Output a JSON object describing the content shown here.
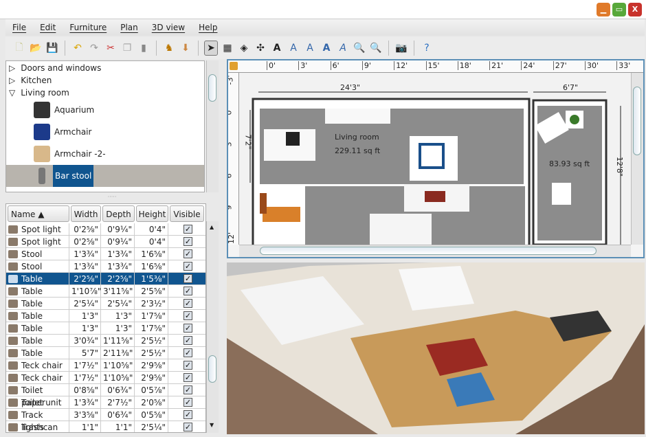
{
  "window": {
    "buttons": [
      "minimize",
      "maximize",
      "close"
    ],
    "colors": {
      "minimize": "#e07a2a",
      "maximize": "#58a83a",
      "close": "#c8322c"
    }
  },
  "menu": [
    "File",
    "Edit",
    "Furniture",
    "Plan",
    "3D view",
    "Help"
  ],
  "toolbar": [
    "new-icon",
    "open-icon",
    "save-icon",
    "undo-icon",
    "redo-icon",
    "cut-icon",
    "copy-icon",
    "paste-icon",
    "add-furniture-icon",
    "import-furniture-icon",
    "select-mode-icon",
    "create-walls-icon",
    "create-rooms-icon",
    "create-dimensions-icon",
    "add-text-icon",
    "text-style-1-icon",
    "text-style-2-icon",
    "bold-text-icon",
    "italic-text-icon",
    "zoom-in-icon",
    "zoom-out-icon",
    "create-photo-icon",
    "help-icon"
  ],
  "catalog": {
    "categories": [
      {
        "label": "Doors and windows",
        "expanded": false
      },
      {
        "label": "Kitchen",
        "expanded": false
      },
      {
        "label": "Living room",
        "expanded": true
      }
    ],
    "items": [
      {
        "label": "Aquarium"
      },
      {
        "label": "Armchair"
      },
      {
        "label": "Armchair -2-"
      },
      {
        "label": "Bar stool",
        "selected": true
      }
    ]
  },
  "furniture": {
    "columns": [
      "Name ▲",
      "Width",
      "Depth",
      "Height",
      "Visible"
    ],
    "rows": [
      {
        "name": "Spot light",
        "width": "0'2⅝\"",
        "depth": "0'9¼\"",
        "height": "0'4\"",
        "visible": true
      },
      {
        "name": "Spot light",
        "width": "0'2⅝\"",
        "depth": "0'9¼\"",
        "height": "0'4\"",
        "visible": true
      },
      {
        "name": "Stool",
        "width": "1'3¾\"",
        "depth": "1'3¾\"",
        "height": "1'6⅝\"",
        "visible": true
      },
      {
        "name": "Stool",
        "width": "1'3¾\"",
        "depth": "1'3¾\"",
        "height": "1'6⅝\"",
        "visible": true
      },
      {
        "name": "Table",
        "width": "2'2⅝\"",
        "depth": "2'2⅝\"",
        "height": "1'5⅜\"",
        "visible": true,
        "selected": true
      },
      {
        "name": "Table",
        "width": "1'10⅞\"",
        "depth": "3'11⅝\"",
        "height": "2'5⅝\"",
        "visible": true
      },
      {
        "name": "Table",
        "width": "2'5¼\"",
        "depth": "2'5¼\"",
        "height": "2'3½\"",
        "visible": true
      },
      {
        "name": "Table",
        "width": "1'3\"",
        "depth": "1'3\"",
        "height": "1'7⅝\"",
        "visible": true
      },
      {
        "name": "Table",
        "width": "1'3\"",
        "depth": "1'3\"",
        "height": "1'7⅝\"",
        "visible": true
      },
      {
        "name": "Table",
        "width": "3'0¾\"",
        "depth": "1'11⅝\"",
        "height": "2'5½\"",
        "visible": true
      },
      {
        "name": "Table",
        "width": "5'7\"",
        "depth": "2'11⅜\"",
        "height": "2'5½\"",
        "visible": true
      },
      {
        "name": "Teck chair",
        "width": "1'7½\"",
        "depth": "1'10⅝\"",
        "height": "2'9⅝\"",
        "visible": true
      },
      {
        "name": "Teck chair",
        "width": "1'7½\"",
        "depth": "1'10⅝\"",
        "height": "2'9⅝\"",
        "visible": true
      },
      {
        "name": "Toilet paper",
        "width": "0'8⅝\"",
        "depth": "0'6¾\"",
        "height": "0'5⅞\"",
        "visible": true
      },
      {
        "name": "Toilet unit",
        "width": "1'3¾\"",
        "depth": "2'7½\"",
        "height": "2'0⅝\"",
        "visible": true
      },
      {
        "name": "Track lights",
        "width": "3'3⅝\"",
        "depth": "0'6¾\"",
        "height": "0'5⅝\"",
        "visible": true
      },
      {
        "name": "Trashcan",
        "width": "1'1\"",
        "depth": "1'1\"",
        "height": "2'5¼\"",
        "visible": true
      }
    ]
  },
  "plan": {
    "ruler_x": [
      "0'",
      "3'",
      "6'",
      "9'",
      "12'",
      "15'",
      "18'",
      "21'",
      "24'",
      "27'",
      "30'",
      "33'"
    ],
    "ruler_y": [
      "-3'",
      "0'",
      "3'",
      "6'",
      "9'",
      "12'"
    ],
    "dimensions": {
      "top_left": "24'3\"",
      "top_right": "6'7\"",
      "left": "7'2\"",
      "right": "12'8\""
    },
    "rooms": [
      {
        "name": "Living room",
        "area": "229.11 sq ft"
      },
      {
        "name": "",
        "area": "83.93 sq ft"
      }
    ]
  },
  "colors": {
    "selection": "#10558f",
    "plan_border": "#5b8fb6",
    "room_floor": "#8c8c8c"
  }
}
